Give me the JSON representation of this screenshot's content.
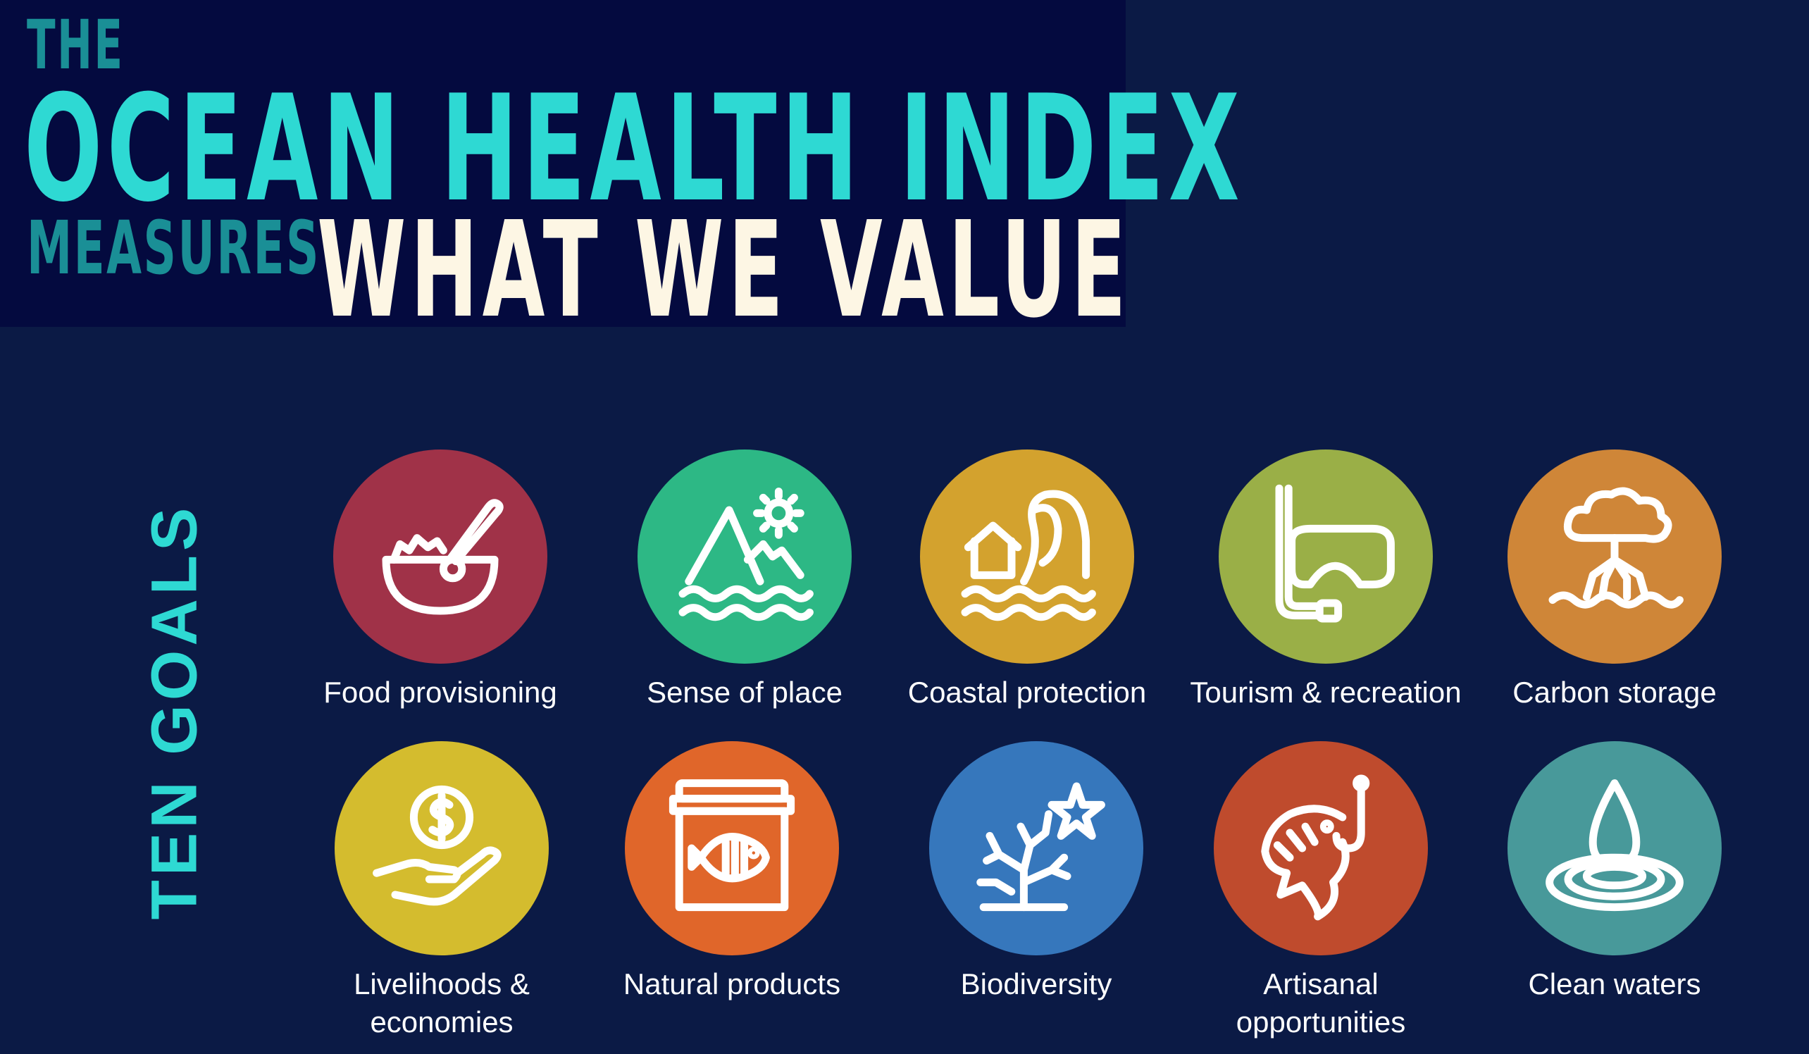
{
  "header": {
    "line1": "THE",
    "line2": "OCEAN HEALTH INDEX",
    "line3": "MEASURES",
    "line4": "WHAT WE VALUE"
  },
  "side_label": "TEN GOALS",
  "colors": {
    "background": "#0b1a45",
    "banner": "#040a3f",
    "title_teal": "#2ed9d3",
    "title_dark_teal": "#1a8f96",
    "title_cream": "#fdf6e4"
  },
  "goals": [
    {
      "label": "Food provisioning",
      "color": "#a03248",
      "icon": "food-bowl-icon"
    },
    {
      "label": "Sense of place",
      "color": "#2db885",
      "icon": "mountain-sun-icon"
    },
    {
      "label": "Coastal protection",
      "color": "#d3a22e",
      "icon": "house-wave-icon"
    },
    {
      "label": "Tourism & recreation",
      "color": "#9aaf47",
      "icon": "snorkel-mask-icon"
    },
    {
      "label": "Carbon storage",
      "color": "#cf8638",
      "icon": "mangrove-tree-icon"
    },
    {
      "label": "Livelihoods &\neconomies",
      "color": "#d4bc2e",
      "icon": "hand-coin-icon"
    },
    {
      "label": "Natural products",
      "color": "#e0662a",
      "icon": "fish-tank-icon"
    },
    {
      "label": "Biodiversity",
      "color": "#3677bc",
      "icon": "coral-starfish-icon"
    },
    {
      "label": "Artisanal opportunities",
      "color": "#bf4b2d",
      "icon": "fish-hook-icon"
    },
    {
      "label": "Clean waters",
      "color": "#48999a",
      "icon": "water-drop-icon"
    }
  ]
}
